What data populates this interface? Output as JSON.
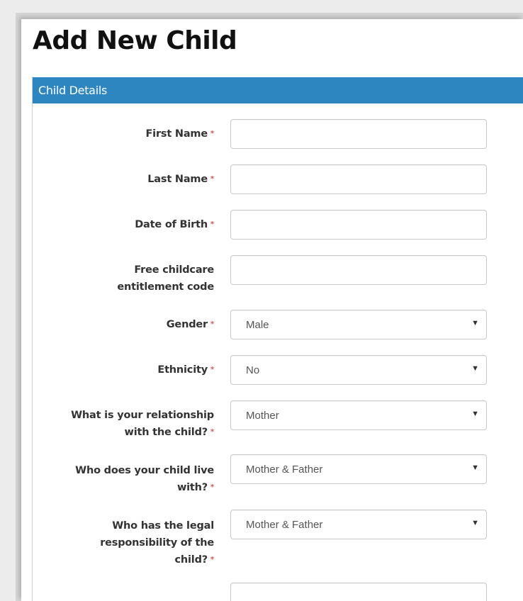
{
  "page": {
    "title": "Add New Child"
  },
  "panel": {
    "header": "Child Details"
  },
  "required_marker": "*",
  "fields": {
    "first_name": {
      "label": "First Name",
      "value": ""
    },
    "last_name": {
      "label": "Last Name",
      "value": ""
    },
    "dob": {
      "label": "Date of Birth",
      "value": ""
    },
    "free_code": {
      "label_line1": "Free childcare",
      "label_line2": "entitlement code",
      "value": ""
    },
    "gender": {
      "label": "Gender",
      "selected": "Male"
    },
    "ethnicity": {
      "label": "Ethnicity",
      "selected": "No"
    },
    "relationship": {
      "label_line1": "What is your relationship",
      "label_line2": "with the child?",
      "selected": "Mother"
    },
    "lives_with": {
      "label_line1": "Who does your child live",
      "label_line2": "with?",
      "selected": "Mother & Father"
    },
    "legal": {
      "label_line1": "Who has the legal",
      "label_line2": "responsibility of the",
      "label_line3": "child?",
      "selected": "Mother & Father"
    }
  },
  "icons": {
    "dropdown": "chevron-down-icon"
  }
}
